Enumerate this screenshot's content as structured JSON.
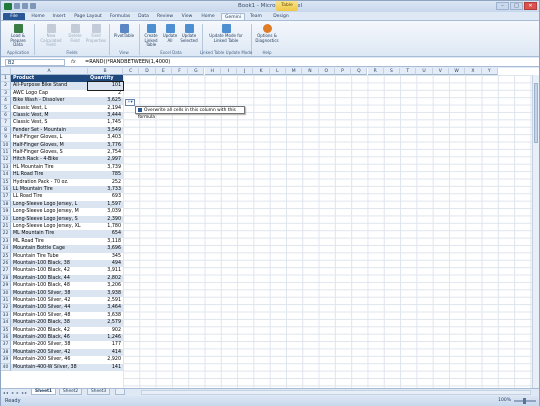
{
  "window": {
    "title": "Book1 - Microsoft Excel",
    "contextual_tab_group": "Table Tools",
    "controls": [
      "–",
      "□",
      "✕"
    ]
  },
  "tabs": [
    "File",
    "Home",
    "Insert",
    "Page Layout",
    "Formulas",
    "Data",
    "Review",
    "View",
    "Home",
    "Gemini",
    "Team",
    "Design"
  ],
  "active_tab": "Design",
  "ribbon": {
    "buttons": [
      {
        "label": "Load & Prepare Data",
        "disabled": false,
        "icon": "database-icon"
      },
      {
        "label": "New Calculated Field",
        "disabled": true,
        "icon": "calculated-field-icon"
      },
      {
        "label": "Delete Field",
        "disabled": true,
        "icon": "delete-icon"
      },
      {
        "label": "Field Properties",
        "disabled": true,
        "icon": "properties-icon"
      },
      {
        "label": "PivotTable",
        "disabled": false,
        "icon": "pivottable-icon"
      },
      {
        "label": "Create Linked Table",
        "disabled": false,
        "icon": "linked-table-icon"
      },
      {
        "label": "Update All",
        "disabled": false,
        "icon": "update-all-icon"
      },
      {
        "label": "Update Selected",
        "disabled": false,
        "icon": "update-selected-icon"
      },
      {
        "label": "Update Mode for Linked Table",
        "disabled": false,
        "icon": "update-mode-icon"
      },
      {
        "label": "Options & Diagnostics",
        "disabled": false,
        "icon": "options-icon"
      }
    ],
    "groups": [
      "Application",
      "Fields",
      "View",
      "Excel Data",
      "Linked Table Update Mode",
      "Help"
    ]
  },
  "formula_bar": {
    "name_box": "B2",
    "fx": "fx",
    "formula": "=RAND()*RANDBETWEEN(1,4000)"
  },
  "columns": [
    "A",
    "B",
    "C",
    "D",
    "E",
    "F",
    "G",
    "H",
    "I",
    "J",
    "K",
    "L",
    "M",
    "N",
    "O",
    "P",
    "Q",
    "R",
    "S",
    "T",
    "U",
    "V",
    "W",
    "X",
    "Y"
  ],
  "table": {
    "headers": [
      "Product",
      "Quantity"
    ],
    "rows": [
      [
        "All-Purpose Bike Stand",
        "101"
      ],
      [
        "AWC Logo Cap",
        "2"
      ],
      [
        "Bike Wash - Dissolver",
        "3,625"
      ],
      [
        "Classic Vest, L",
        "2,194"
      ],
      [
        "Classic Vest, M",
        "3,444"
      ],
      [
        "Classic Vest, S",
        "1,745"
      ],
      [
        "Fender Set - Mountain",
        "3,549"
      ],
      [
        "Half-Finger Gloves, L",
        "3,403"
      ],
      [
        "Half-Finger Gloves, M",
        "3,776"
      ],
      [
        "Half-Finger Gloves, S",
        "2,754"
      ],
      [
        "Hitch Rack - 4-Bike",
        "2,997"
      ],
      [
        "HL Mountain Tire",
        "3,739"
      ],
      [
        "HL Road Tire",
        "785"
      ],
      [
        "Hydration Pack - 70 oz.",
        "252"
      ],
      [
        "LL Mountain Tire",
        "3,733"
      ],
      [
        "LL Road Tire",
        "693"
      ],
      [
        "Long-Sleeve Logo Jersey, L",
        "1,597"
      ],
      [
        "Long-Sleeve Logo Jersey, M",
        "3,039"
      ],
      [
        "Long-Sleeve Logo Jersey, S",
        "2,390"
      ],
      [
        "Long-Sleeve Logo Jersey, XL",
        "1,780"
      ],
      [
        "ML Mountain Tire",
        "654"
      ],
      [
        "ML Road Tire",
        "3,118"
      ],
      [
        "Mountain Bottle Cage",
        "3,696"
      ],
      [
        "Mountain Tire Tube",
        "345"
      ],
      [
        "Mountain-100 Black, 38",
        "494"
      ],
      [
        "Mountain-100 Black, 42",
        "3,911"
      ],
      [
        "Mountain-100 Black, 44",
        "2,802"
      ],
      [
        "Mountain-100 Black, 48",
        "3,206"
      ],
      [
        "Mountain-100 Silver, 38",
        "3,938"
      ],
      [
        "Mountain-100 Silver, 42",
        "2,591"
      ],
      [
        "Mountain-100 Silver, 44",
        "3,464"
      ],
      [
        "Mountain-100 Silver, 48",
        "3,638"
      ],
      [
        "Mountain-200 Black, 38",
        "2,579"
      ],
      [
        "Mountain-200 Black, 42",
        "902"
      ],
      [
        "Mountain-200 Black, 46",
        "1,246"
      ],
      [
        "Mountain-200 Silver, 38",
        "177"
      ],
      [
        "Mountain-200 Silver, 42",
        "414"
      ],
      [
        "Mountain-200 Silver, 46",
        "2,920"
      ],
      [
        "Mountain-400-W Silver, 38",
        "141"
      ]
    ]
  },
  "autocorrect_tooltip": "Overwrite all cells in this column with this formula",
  "autocorrect_button": "⚡▾",
  "sheets": [
    "Sheet1",
    "Sheet2",
    "Sheet3"
  ],
  "sheet_nav": "◂◂ ◂ ▸ ▸▸",
  "active_sheet": "Sheet1",
  "status": {
    "mode": "Ready",
    "zoom": "100%"
  },
  "colors": {
    "accent": "#2b5797",
    "table_header": "#1f497d",
    "band": "#dbe5f1"
  }
}
